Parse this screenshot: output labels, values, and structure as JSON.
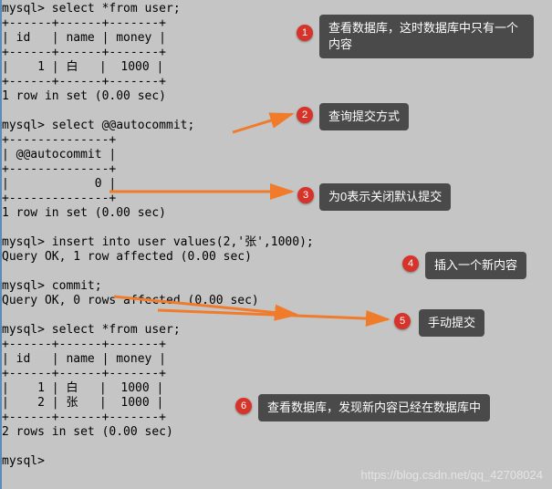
{
  "terminal": {
    "block1": "mysql> select *from user;\n+------+------+-------+\n| id   | name | money |\n+------+------+-------+\n|    1 | 白   |  1000 |\n+------+------+-------+\n1 row in set (0.00 sec)\n\nmysql> select @@autocommit;\n+--------------+\n| @@autocommit |\n+--------------+\n|            0 |\n+--------------+\n1 row in set (0.00 sec)\n\nmysql> insert into user values(2,'张',1000);\nQuery OK, 1 row affected (0.00 sec)\n\nmysql> commit;\nQuery OK, 0 rows affected (0.00 sec)\n\nmysql> select *from user;\n+------+------+-------+\n| id   | name | money |\n+------+------+-------+\n|    1 | 白   |  1000 |\n|    2 | 张   |  1000 |\n+------+------+-------+\n2 rows in set (0.00 sec)\n\nmysql>"
  },
  "callouts": {
    "c1": "查看数据库，这时数据库中只有一个内容",
    "c2": "查询提交方式",
    "c3": "为0表示关闭默认提交",
    "c4": "插入一个新内容",
    "c5": "手动提交",
    "c6": "查看数据库，发现新内容已经在数据库中"
  },
  "badges": {
    "b1": "1",
    "b2": "2",
    "b3": "3",
    "b4": "4",
    "b5": "5",
    "b6": "6"
  },
  "watermark": "https://blog.csdn.net/qq_42708024"
}
